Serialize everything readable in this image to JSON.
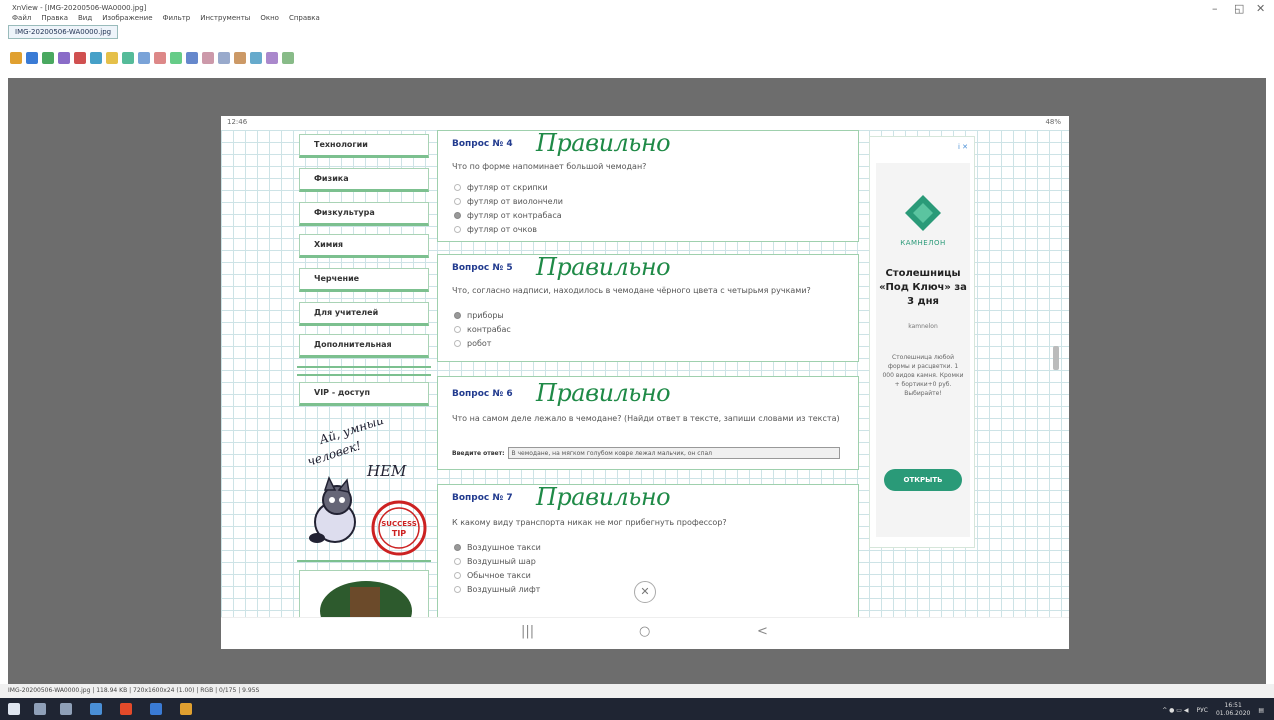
{
  "app": {
    "title": "XnView - [IMG-20200506-WA0000.jpg]",
    "menu": [
      "Файл",
      "Правка",
      "Вид",
      "Изображение",
      "Фильтр",
      "Инструменты",
      "Окно",
      "Справка"
    ],
    "tab": "IMG-20200506-WA0000.jpg",
    "status": "IMG-20200506-WA0000.jpg | 118.94 KB | 720x1600x24 (1.00) | RGB | 0/175 | 9.95S"
  },
  "phone": {
    "time": "12:46",
    "battery": "48%",
    "nav_buttons": [
      "|||",
      "○",
      "<"
    ]
  },
  "sidebar": {
    "items": [
      "Технологии",
      "Физика",
      "Физкультура",
      "Химия",
      "Черчение",
      "Для учителей",
      "Дополнительная"
    ],
    "vip": "VIP - доступ",
    "handwriting": "Ай, умный человек! НЕМ",
    "stamp": "SUCCESS TIP"
  },
  "questions": [
    {
      "title": "Вопрос № 4",
      "verdict": "Правильно",
      "text": "Что по форме напоминает большой чемодан?",
      "options": [
        {
          "label": "футляр от скрипки",
          "selected": false
        },
        {
          "label": "футляр от виолончели",
          "selected": false
        },
        {
          "label": "футляр от контрабаса",
          "selected": true
        },
        {
          "label": "футляр от очков",
          "selected": false
        }
      ]
    },
    {
      "title": "Вопрос № 5",
      "verdict": "Правильно",
      "text": "Что, согласно надписи, находилось в чемодане чёрного цвета с четырьмя ручками?",
      "options": [
        {
          "label": "приборы",
          "selected": true
        },
        {
          "label": "контрабас",
          "selected": false
        },
        {
          "label": "робот",
          "selected": false
        }
      ]
    },
    {
      "title": "Вопрос № 6",
      "verdict": "Правильно",
      "text": "Что на самом деле лежало в чемодане? (Найди ответ в тексте, запиши словами из текста)",
      "answer_label": "Введите ответ:",
      "answer_value": "В чемодане, на мягком голубом ковре лежал мальчик, он спал"
    },
    {
      "title": "Вопрос № 7",
      "verdict": "Правильно",
      "text": "К какому виду транспорта никак не мог прибегнуть профессор?",
      "options": [
        {
          "label": "Воздушное такси",
          "selected": true
        },
        {
          "label": "Воздушный шар",
          "selected": false
        },
        {
          "label": "Обычное такси",
          "selected": false
        },
        {
          "label": "Воздушный лифт",
          "selected": false
        }
      ]
    }
  ],
  "ad": {
    "marker": "i ✕",
    "brand": "КАМНЕЛОН",
    "headline": "Столешницы «Под Ключ» за 3 дня",
    "advertiser": "kamnelon",
    "body": "Столешница любой формы и расцветки. 1 000 видов камня. Кромки + бортики+0 руб. Выбирайте!",
    "cta": "ОТКРЫТЬ"
  },
  "taskbar": {
    "lang": "РУС",
    "time": "16:51",
    "date": "01.06.2020"
  },
  "colors": {
    "accent_green": "#1f8a47",
    "question_blue": "#223b8f",
    "ad_teal": "#2a9a78"
  }
}
